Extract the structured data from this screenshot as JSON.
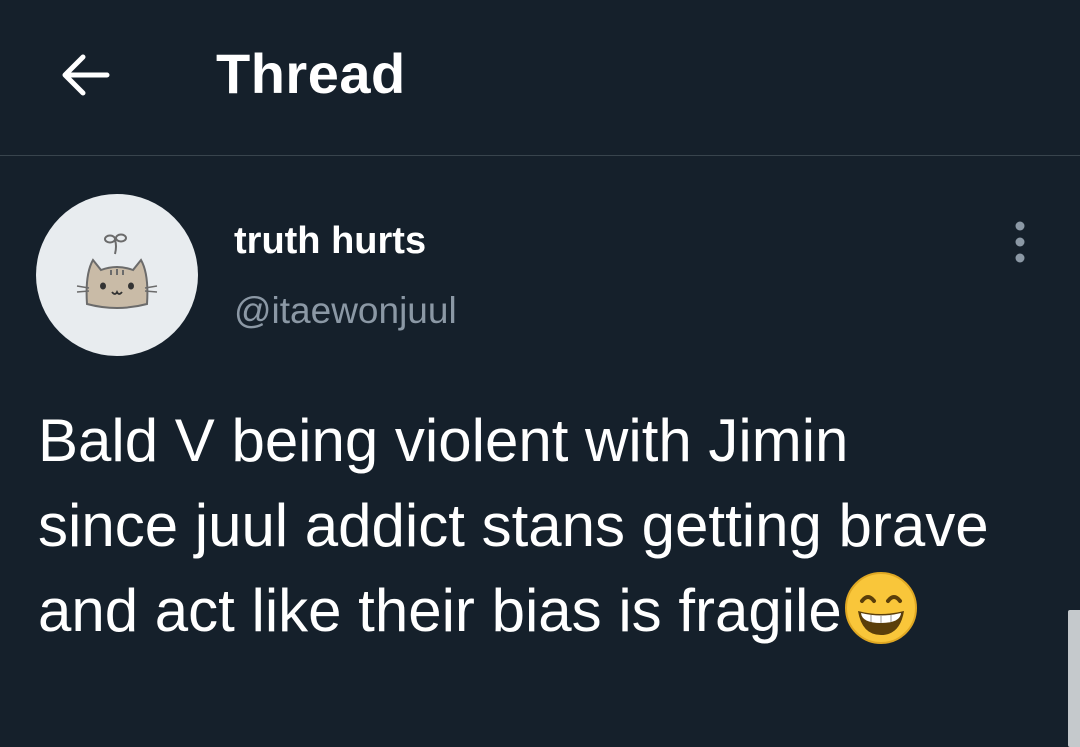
{
  "header": {
    "back_icon": "arrow-left-icon",
    "title": "Thread"
  },
  "tweet": {
    "avatar_icon": "cat-avatar-icon",
    "display_name": "truth hurts",
    "handle": "@itaewonjuul",
    "more_icon": "vertical-ellipsis-icon",
    "text": "Bald V being violent with Jimin since juul addict stans getting brave and act like their bias is fragile",
    "emoji": "😁",
    "emoji_name": "grinning-face-icon"
  },
  "colors": {
    "background": "#15202b",
    "divider": "#38444d",
    "text_primary": "#ffffff",
    "text_secondary": "#8b98a5",
    "avatar_bg": "#e8ecef",
    "emoji_yellow": "#f9c63a"
  }
}
